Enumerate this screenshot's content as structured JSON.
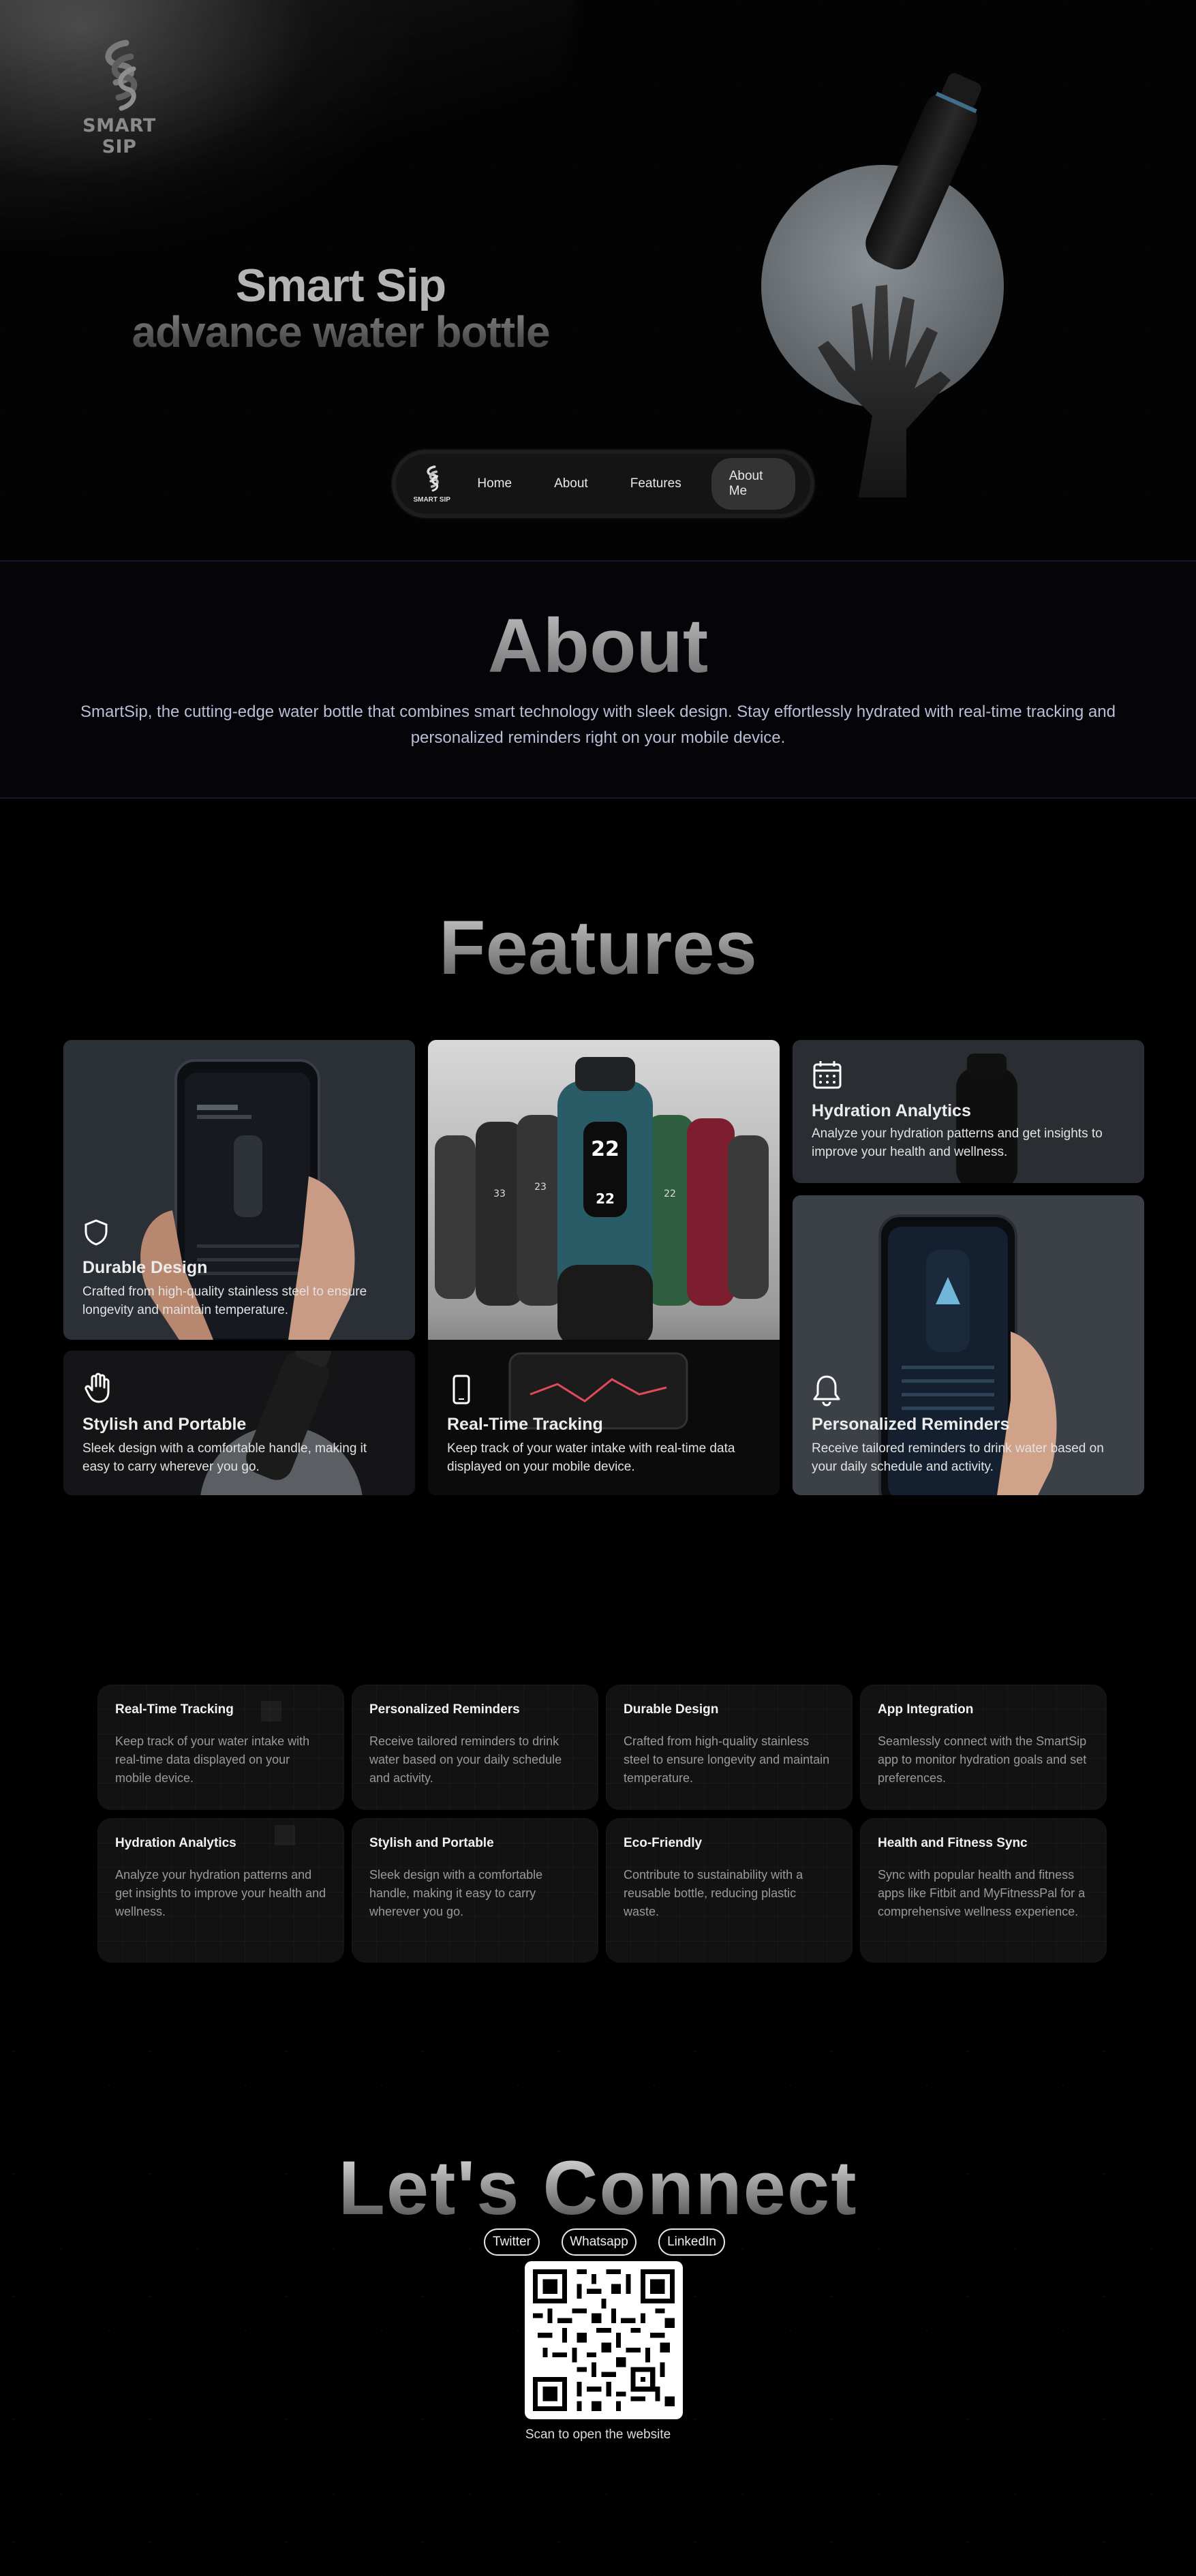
{
  "brand": {
    "logo_text": "SMART SIP",
    "nav_logo_text": "SMART SIP"
  },
  "hero": {
    "title": "Smart Sip",
    "subtitle": "advance water bottle"
  },
  "nav": {
    "items": [
      {
        "label": "Home"
      },
      {
        "label": "About"
      },
      {
        "label": "Features"
      },
      {
        "label": "About Me"
      }
    ],
    "active": "About Me"
  },
  "about": {
    "title": "About",
    "text": "SmartSip, the cutting-edge water bottle that combines smart technology with sleek design. Stay effortlessly hydrated with real-time tracking and personalized reminders right on your mobile device."
  },
  "features": {
    "title": "Features",
    "cards": [
      {
        "title": "Durable Design",
        "desc": "Crafted from high-quality stainless steel to ensure longevity and maintain temperature.",
        "icon": "shield-icon"
      },
      {
        "title": "Stylish and Portable",
        "desc": "Sleek design with a comfortable handle, making it easy to carry wherever you go.",
        "icon": "hand-icon"
      },
      {
        "title": "Real-Time Tracking",
        "desc": "Keep track of your water intake with real-time data displayed on your mobile device.",
        "icon": "smartphone-icon"
      },
      {
        "title": "Hydration Analytics",
        "desc": "Analyze your hydration patterns and get insights to improve your health and wellness.",
        "icon": "calendar-icon"
      },
      {
        "title": "Personalized Reminders",
        "desc": "Receive tailored reminders to drink water based on your daily schedule and activity.",
        "icon": "bell-icon"
      }
    ],
    "bottle_screen_values": [
      "22",
      "22",
      "33",
      "23",
      "22"
    ]
  },
  "grid": {
    "tiles": [
      {
        "title": "Real-Time Tracking",
        "desc": "Keep track of your water intake with real-time data displayed on your mobile device."
      },
      {
        "title": "Personalized Reminders",
        "desc": "Receive tailored reminders to drink water based on your daily schedule and activity."
      },
      {
        "title": "Durable Design",
        "desc": "Crafted from high-quality stainless steel to ensure longevity and maintain temperature."
      },
      {
        "title": "App Integration",
        "desc": "Seamlessly connect with the SmartSip app to monitor hydration goals and set preferences."
      },
      {
        "title": "Hydration Analytics",
        "desc": "Analyze your hydration patterns and get insights to improve your health and wellness."
      },
      {
        "title": "Stylish and Portable",
        "desc": "Sleek design with a comfortable handle, making it easy to carry wherever you go."
      },
      {
        "title": "Eco-Friendly",
        "desc": "Contribute to sustainability with a reusable bottle, reducing plastic waste."
      },
      {
        "title": "Health and Fitness Sync",
        "desc": "Sync with popular health and fitness apps like Fitbit and MyFitnessPal for a comprehensive wellness experience."
      }
    ]
  },
  "connect": {
    "title": "Let's Connect",
    "links": [
      "Twitter",
      "Whatsapp",
      "LinkedIn"
    ],
    "qr_caption": "Scan to open the website"
  },
  "colors": {
    "background": "#000000",
    "about_text": "#b8bfd6",
    "nav_bg": "#141414",
    "nav_active": "#333333"
  }
}
